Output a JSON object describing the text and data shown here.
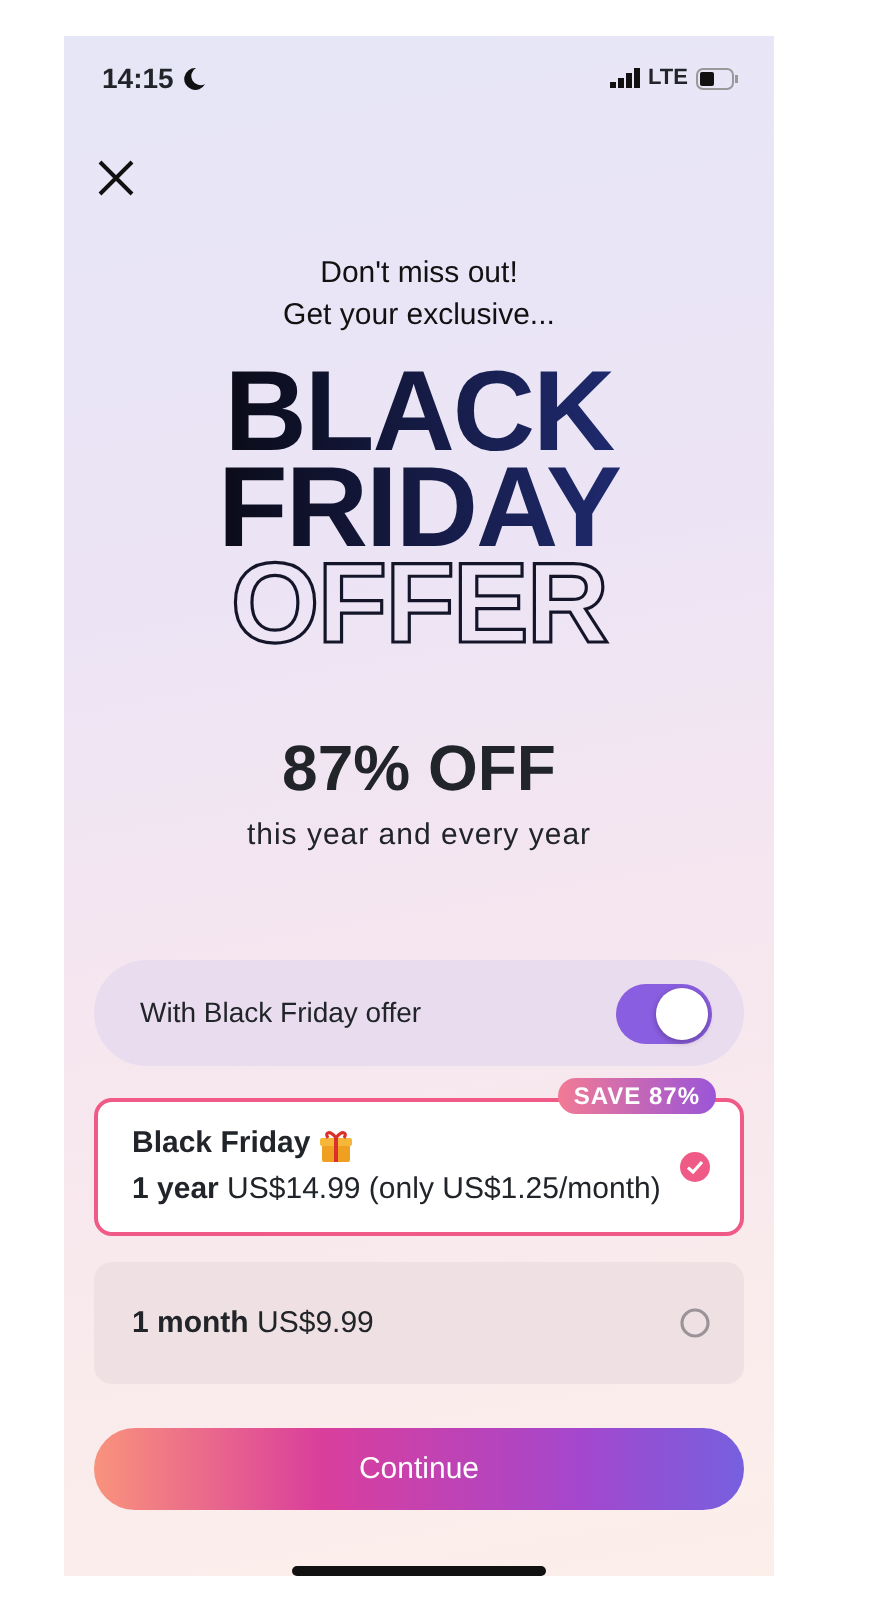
{
  "status_bar": {
    "time": "14:15",
    "network": "LTE"
  },
  "header": {
    "lines": [
      "Don't miss out!",
      "Get your exclusive..."
    ]
  },
  "title_lines": [
    {
      "text": "BLACK",
      "kind": "filled"
    },
    {
      "text": "FRIDAY",
      "kind": "filled"
    },
    {
      "text": "OFFER",
      "kind": "outline"
    }
  ],
  "discount": {
    "headline": "87% OFF",
    "subtitle": "this year and every year"
  },
  "offer_toggle": {
    "label": "With Black Friday offer",
    "on": true
  },
  "plans": [
    {
      "title": "Black Friday",
      "badge": "SAVE 87%",
      "detail": "**1 year** US$14.99 (only US$1.25/month)",
      "selected": true
    },
    {
      "detail": "**1 month** US$9.99",
      "selected": false
    }
  ],
  "button": {
    "label": "Continue"
  }
}
